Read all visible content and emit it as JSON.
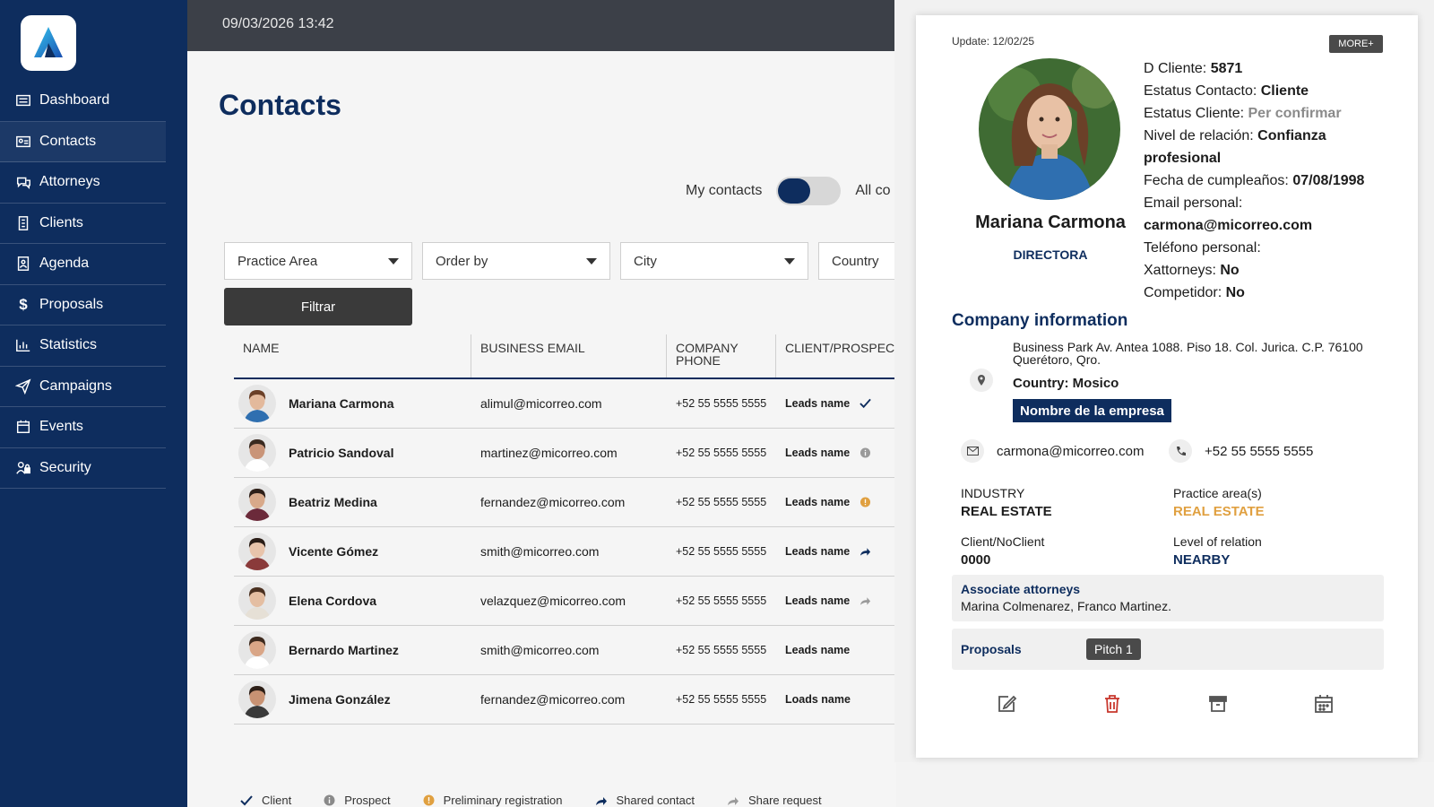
{
  "topbar": {
    "datetime": "09/03/2026 13:42"
  },
  "sidebar": {
    "items": [
      {
        "label": "Dashboard",
        "icon": "dashboard-icon"
      },
      {
        "label": "Contacts",
        "icon": "contacts-icon"
      },
      {
        "label": "Attorneys",
        "icon": "attorneys-icon"
      },
      {
        "label": "Clients",
        "icon": "clients-icon"
      },
      {
        "label": "Agenda",
        "icon": "agenda-icon"
      },
      {
        "label": "Proposals",
        "icon": "dollar-icon"
      },
      {
        "label": "Statistics",
        "icon": "chart-icon"
      },
      {
        "label": "Campaigns",
        "icon": "send-icon"
      },
      {
        "label": "Events",
        "icon": "calendar-icon"
      },
      {
        "label": "Security",
        "icon": "security-icon"
      }
    ]
  },
  "main": {
    "title": "Contacts",
    "toggle": {
      "left_label": "My contacts",
      "right_label": "All co"
    },
    "filters": {
      "practice_area": "Practice Area",
      "order_by": "Order by",
      "city": "City",
      "country": "Country",
      "button": "Filtrar"
    },
    "table": {
      "headers": {
        "name": "NAME",
        "email": "BUSINESS EMAIL",
        "phone_line1": "COMPANY",
        "phone_line2": "PHONE",
        "status": "CLIENT/PROSPECT"
      },
      "rows": [
        {
          "name": "Mariana Carmona",
          "email": "alimul@micorreo.com",
          "phone": "+52 55 5555 5555",
          "lead": "Leads name",
          "status": "client"
        },
        {
          "name": "Patricio Sandoval",
          "email": "martinez@micorreo.com",
          "phone": "+52 55 5555 5555",
          "lead": "Leads name",
          "status": "prospect"
        },
        {
          "name": "Beatriz Medina",
          "email": "fernandez@micorreo.com",
          "phone": "+52 55 5555 5555",
          "lead": "Leads name",
          "status": "preliminary"
        },
        {
          "name": "Vicente Gómez",
          "email": "smith@micorreo.com",
          "phone": "+52 55 5555 5555",
          "lead": "Leads name",
          "status": "shared"
        },
        {
          "name": "Elena Cordova",
          "email": "velazquez@micorreo.com",
          "phone": "+52 55 5555 5555",
          "lead": "Leads name",
          "status": "share-request"
        },
        {
          "name": "Bernardo Martinez",
          "email": "smith@micorreo.com",
          "phone": "+52 55 5555 5555",
          "lead": "Leads name",
          "status": "none"
        },
        {
          "name": "Jimena González",
          "email": "fernandez@micorreo.com",
          "phone": "+52 55 5555 5555",
          "lead": "Loads name",
          "status": "none"
        }
      ]
    },
    "legend": {
      "client": "Client",
      "prospect": "Prospect",
      "preliminary": "Preliminary registration",
      "shared": "Shared contact",
      "share_request": "Share request"
    }
  },
  "panel": {
    "update": "Update: 12/02/25",
    "more": "MORE+",
    "name": "Mariana Carmona",
    "role": "DIRECTORA",
    "details": {
      "id_label": "D Cliente: ",
      "id_value": "5871",
      "contact_status_label": "Estatus Contacto: ",
      "contact_status_value": "Cliente",
      "client_status_label": "Estatus Cliente: ",
      "client_status_value": "Per confirmar",
      "relation_label": "Nivel de relación: ",
      "relation_value_1": "Confianza",
      "relation_value_2": "profesional",
      "birthday_label": "Fecha de cumpleaños: ",
      "birthday_value": "07/08/1998",
      "email_label": "Email personal:",
      "email_value": "carmona@micorreo.com",
      "phone_label": "Teléfono personal:",
      "xattorneys_label": "Xattorneys: ",
      "xattorneys_value": "No",
      "competitor_label": "Competidor: ",
      "competitor_value": "No"
    },
    "company": {
      "title": "Company information",
      "address_1": "Business Park Av. Antea 1088. Piso 18. Col. Jurica. C.P. 76100",
      "address_2": "Querétoro, Qro.",
      "country": "Country: Mosico",
      "company_name": "Nombre de la empresa",
      "email": "carmona@micorreo.com",
      "phone": "+52 55 5555 5555",
      "industry_label": "INDUSTRY",
      "industry_value": "REAL ESTATE",
      "practice_label": "Practice area(s)",
      "practice_value": "REAL ESTATE",
      "client_label": "Client/NoClient",
      "client_value": "0000",
      "level_label": "Level of relation",
      "level_value": "NEARBY"
    },
    "associates": {
      "title": "Associate attorneys",
      "names": "Marina Colmenarez, Franco Martinez."
    },
    "proposals": {
      "title": "Proposals",
      "pitch": "Pitch 1"
    }
  },
  "colors": {
    "navy": "#0e2d5e",
    "orange": "#e0a040",
    "red": "#c8372d",
    "grey_dark": "#3c4048"
  }
}
